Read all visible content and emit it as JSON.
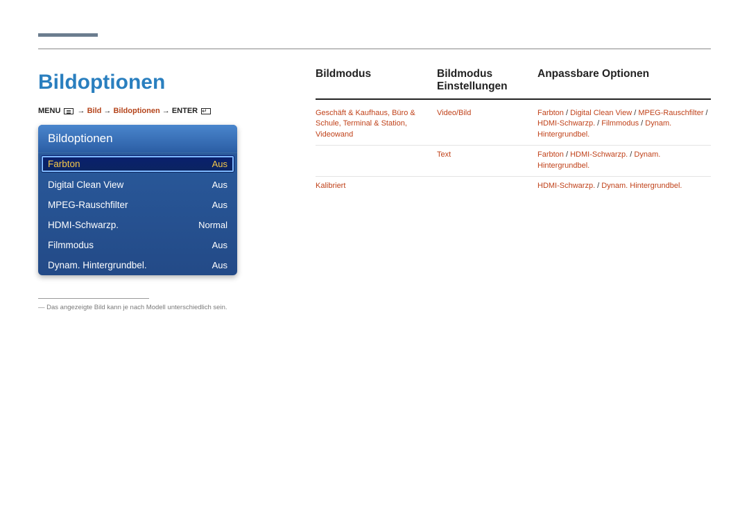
{
  "title": "Bildoptionen",
  "breadcrumb": {
    "menu": "MENU",
    "seg1": "Bild",
    "seg2": "Bildoptionen",
    "enter": "ENTER"
  },
  "osd": {
    "header": "Bildoptionen",
    "rows": [
      {
        "label": "Farbton",
        "value": "Aus",
        "selected": true
      },
      {
        "label": "Digital Clean View",
        "value": "Aus",
        "selected": false
      },
      {
        "label": "MPEG-Rauschfilter",
        "value": "Aus",
        "selected": false
      },
      {
        "label": "HDMI-Schwarzp.",
        "value": "Normal",
        "selected": false
      },
      {
        "label": "Filmmodus",
        "value": "Aus",
        "selected": false
      },
      {
        "label": "Dynam. Hintergrundbel.",
        "value": "Aus",
        "selected": false
      }
    ]
  },
  "footnote": "― Das angezeigte Bild kann je nach Modell unterschiedlich sein.",
  "table": {
    "headers": {
      "c1": "Bildmodus",
      "c2": "Bildmodus Einstellungen",
      "c3": "Anpassbare Optionen"
    },
    "rows": [
      {
        "c1_parts": [
          "Geschäft & Kaufhaus",
          ", ",
          "Büro & Schule",
          ", ",
          "Terminal & Station",
          ", ",
          "Videowand"
        ],
        "c2": "Video/Bild",
        "c3_parts": [
          "Farbton",
          " / ",
          "Digital Clean View",
          " / ",
          "MPEG-Rauschfilter",
          " / ",
          "HDMI-Schwarzp.",
          " / ",
          "Filmmodus",
          " / ",
          "Dynam. Hintergrundbel."
        ]
      },
      {
        "c1_parts": [],
        "c2": "Text",
        "c3_parts": [
          "Farbton",
          " / ",
          "HDMI-Schwarzp.",
          " / ",
          "Dynam. Hintergrundbel."
        ]
      },
      {
        "c1_plain": "Kalibriert",
        "c2": "",
        "c3_parts": [
          "HDMI-Schwarzp.",
          " / ",
          "Dynam. Hintergrundbel."
        ]
      }
    ]
  }
}
